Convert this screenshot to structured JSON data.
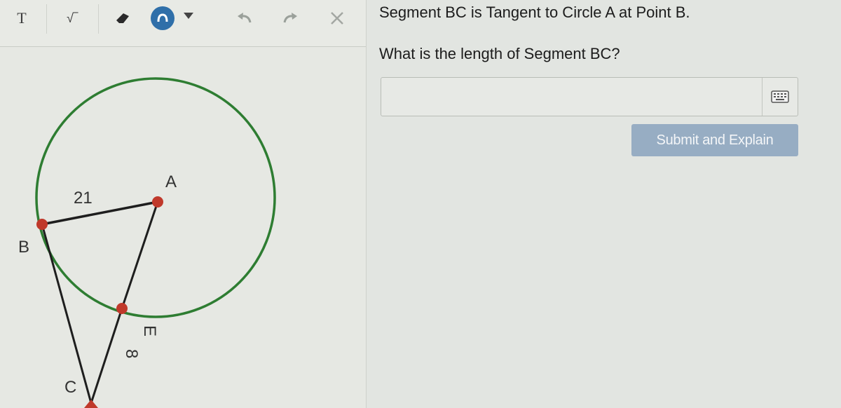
{
  "toolbar": {
    "text_tool_glyph": "T",
    "sqrt_tool_glyph": "√‾",
    "tools": [
      "text-icon",
      "sqrt-icon",
      "eraser-icon",
      "snap-icon",
      "undo-icon",
      "redo-icon",
      "close-icon"
    ]
  },
  "question": {
    "line1": "Segment BC is Tangent to Circle A at Point B.",
    "line2": "What is the length of Segment BC?"
  },
  "answer": {
    "value": "",
    "placeholder": ""
  },
  "submit_label": "Submit and Explain",
  "diagram": {
    "point_labels": {
      "A": "A",
      "B": "B",
      "C": "C",
      "E": "E"
    },
    "segment_labels": {
      "AB": "21",
      "CE": "8"
    }
  },
  "colors": {
    "circle": "#2e7d32",
    "point": "#c0392b",
    "accent_button": "#97adc3",
    "snap_button": "#2f6fa9"
  }
}
